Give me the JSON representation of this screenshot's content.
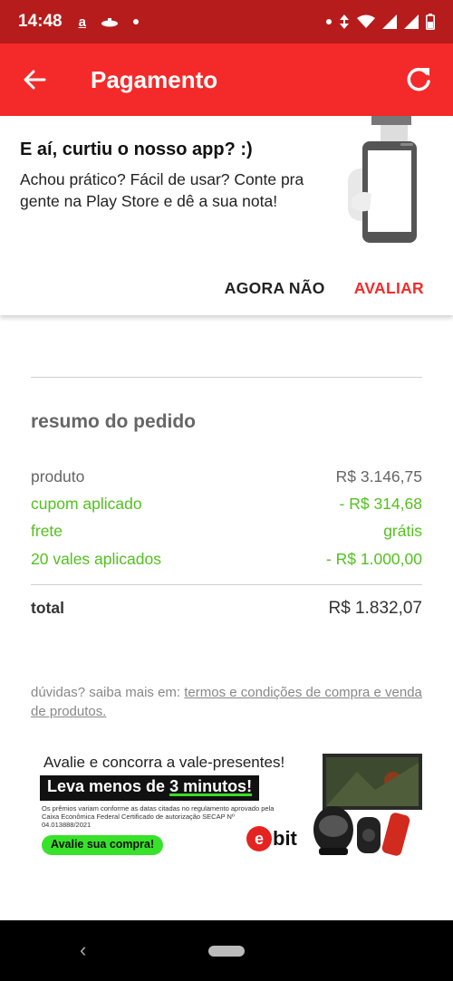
{
  "status_bar": {
    "time": "14:48",
    "icons": [
      "amazon-icon",
      "submarine-icon",
      "dot-icon",
      "data-saver-icon",
      "wifi-icon",
      "signal-icon",
      "signal-icon",
      "battery-icon"
    ]
  },
  "app_bar": {
    "title": "Pagamento"
  },
  "rating_prompt": {
    "title": "E aí, curtiu o nosso app? :)",
    "text": "Achou prático? Fácil de usar? Conte pra gente na Play Store e dê a sua nota!",
    "not_now_label": "AGORA NÃO",
    "rate_label": "AVALIAR"
  },
  "summary": {
    "title": "resumo do pedido",
    "rows": [
      {
        "label": "produto",
        "value": "R$ 3.146,75"
      },
      {
        "label": "cupom aplicado",
        "value": "- R$ 314,68"
      },
      {
        "label": "frete",
        "value": "grátis"
      },
      {
        "label": "20 vales aplicados",
        "value": "- R$ 1.000,00"
      }
    ],
    "total_label": "total",
    "total_value": "R$ 1.832,07"
  },
  "help": {
    "prefix": "dúvidas? saiba mais em: ",
    "link_text": "termos e condições de compra e venda de produtos."
  },
  "banner": {
    "headline": "Avalie e concorra a vale-presentes!",
    "subheadline_prefix": "Leva menos de ",
    "subheadline_highlight": "3 minutos!",
    "fine_print": "Os prêmios variam conforme as datas citadas no regulamento aprovado pela Caixa Econômica Federal Certificado de autorização SECAP Nº 04.013888/2021",
    "cta": "Avalie sua compra!",
    "logo_text": "bit"
  },
  "colors": {
    "status_bar": "#b71c1c",
    "app_bar": "#f42a2a",
    "accent_green": "#53c11f",
    "rate_button": "#f42a2a"
  }
}
